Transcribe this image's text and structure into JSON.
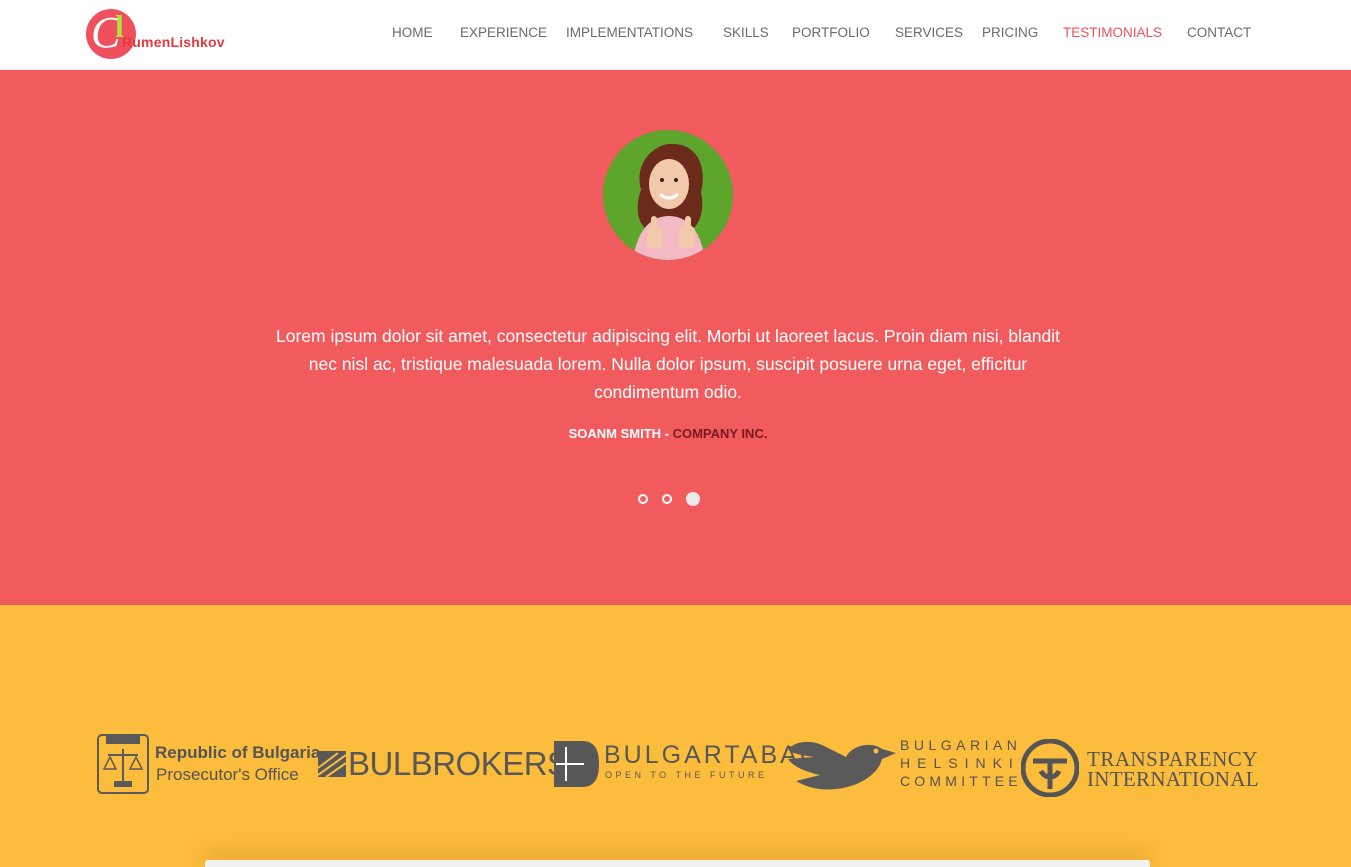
{
  "brand": {
    "name": "RumenLishkov",
    "accent": "#f0505e",
    "secondary": "#aee23a"
  },
  "nav": {
    "items": [
      {
        "label": "HOME"
      },
      {
        "label": "EXPERIENCE"
      },
      {
        "label": "IMPLEMENTATIONS"
      },
      {
        "label": "SKILLS"
      },
      {
        "label": "PORTFOLIO"
      },
      {
        "label": "SERVICES"
      },
      {
        "label": "PRICING"
      },
      {
        "label": "TESTIMONIALS"
      },
      {
        "label": "CONTACT"
      }
    ],
    "active": "TESTIMONIALS"
  },
  "testimonial": {
    "quote": "Lorem ipsum dolor sit amet, consectetur adipiscing elit. Morbi ut laoreet lacus. Proin diam nisi, blandit nec nisl ac, tristique malesuada lorem. Nulla dolor ipsum, suscipit posuere urna eget, efficitur condimentum odio.",
    "author": "SOANM SMITH -",
    "company": "COMPANY INC.",
    "slides": 3,
    "active_slide": 3,
    "background": "#f25b5e"
  },
  "clients": {
    "background": "#fcbc3c",
    "logos": [
      {
        "line1": "Republic of Bulgaria",
        "line2": "Prosecutor's Office",
        "seal": "PROSECUTION"
      },
      {
        "name": "BULBROKERS"
      },
      {
        "name": "BULGARTABAC",
        "tagline": "OPEN TO THE FUTURE"
      },
      {
        "line1": "BULGARIAN",
        "line2": "HELSINKI",
        "line3": "COMMITTEE"
      },
      {
        "line1": "TRANSPARENCY",
        "line2": "INTERNATIONAL"
      }
    ]
  }
}
